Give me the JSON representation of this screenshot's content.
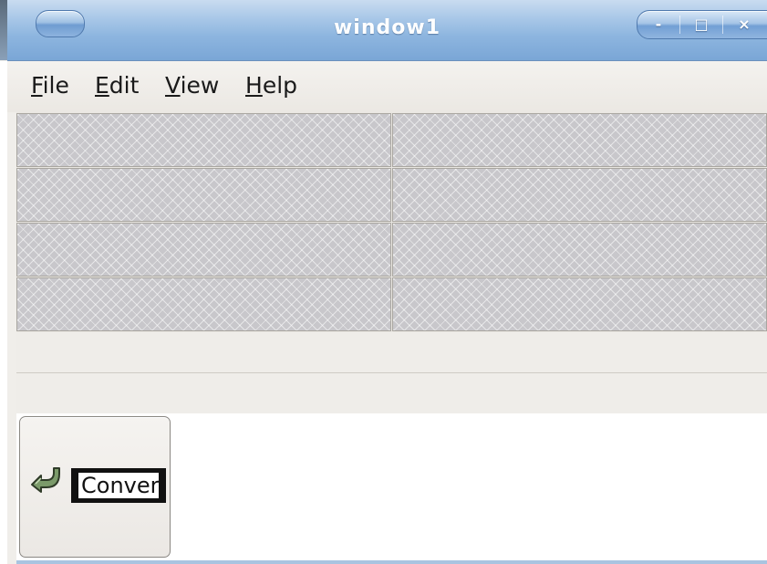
{
  "window": {
    "title": "window1",
    "controls": {
      "minimize": "-",
      "maximize": "□",
      "close": "×"
    }
  },
  "menubar": {
    "items": [
      {
        "label": "File",
        "mnemonic": "F",
        "rest": "ile"
      },
      {
        "label": "Edit",
        "mnemonic": "E",
        "rest": "dit"
      },
      {
        "label": "View",
        "mnemonic": "V",
        "rest": "iew"
      },
      {
        "label": "Help",
        "mnemonic": "H",
        "rest": "elp"
      }
    ]
  },
  "grid": {
    "rows": 4,
    "columns": 2
  },
  "convert_button": {
    "label": "Conver",
    "icon": "convert-arrow-icon"
  },
  "colors": {
    "titlebar": "#8db5df",
    "cell": "#c8c7cb",
    "background": "#f0eeea"
  }
}
